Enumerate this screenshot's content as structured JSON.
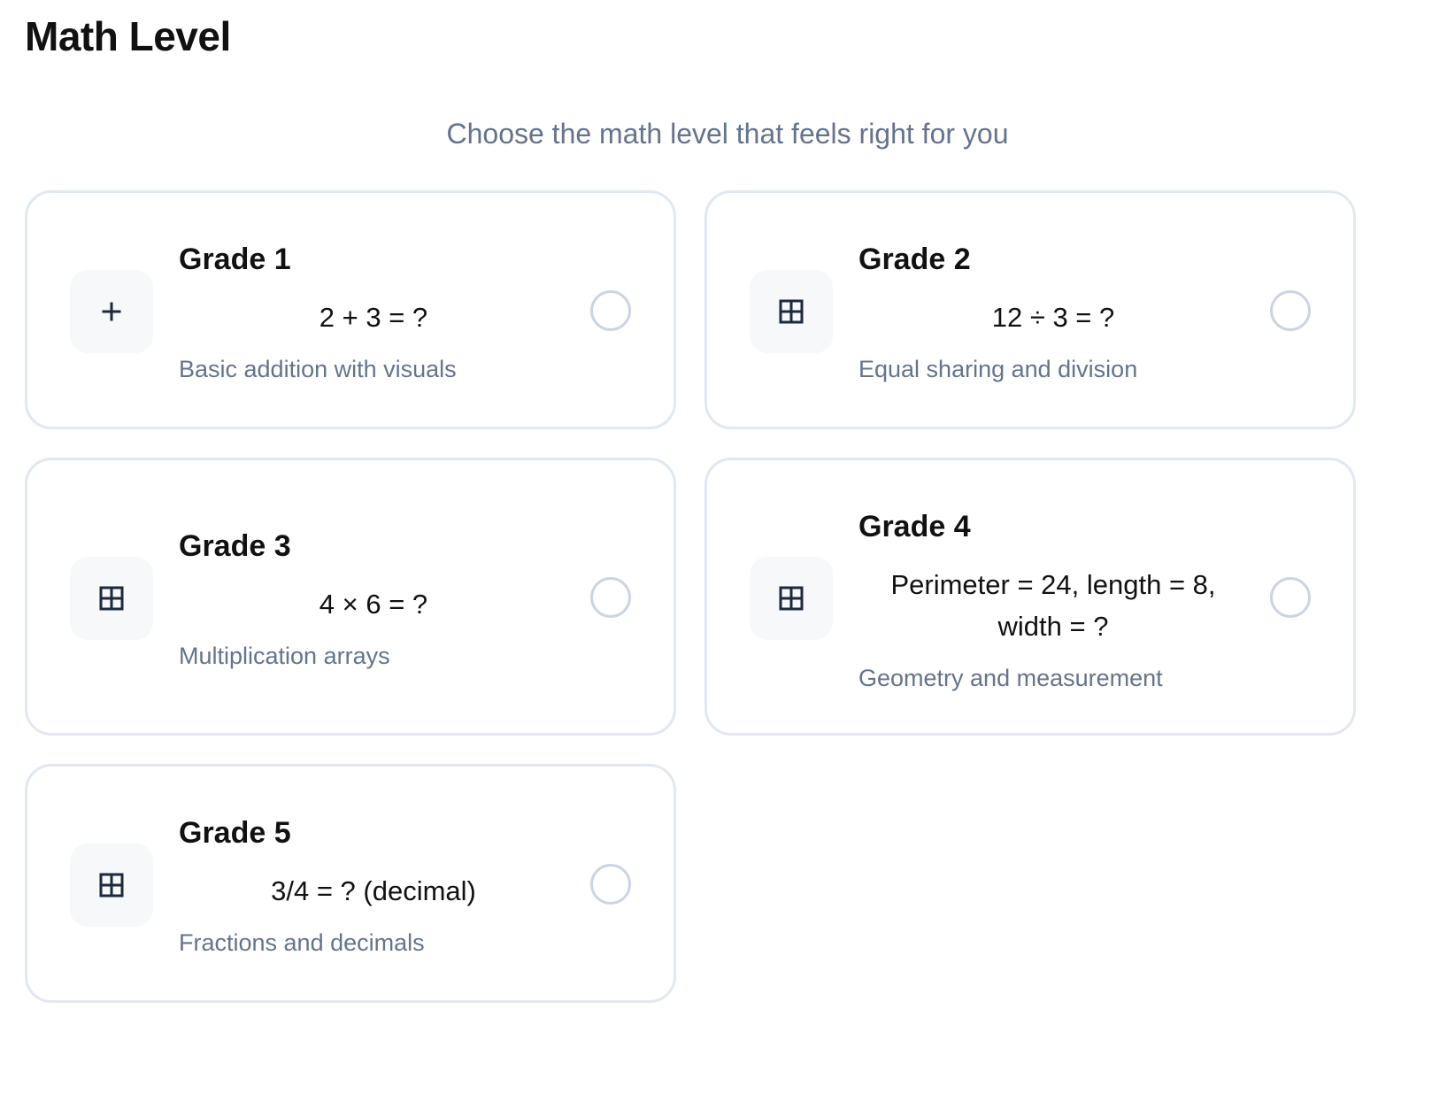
{
  "page": {
    "title": "Math Level",
    "subtitle": "Choose the math level that feels right for you"
  },
  "levels": [
    {
      "grade": "Grade 1",
      "problem": "2 + 3 = ?",
      "description": "Basic addition with visuals",
      "icon": "plus-icon",
      "selected": false
    },
    {
      "grade": "Grade 2",
      "problem": "12 ÷ 3 = ?",
      "description": "Equal sharing and division",
      "icon": "grid-icon",
      "selected": false
    },
    {
      "grade": "Grade 3",
      "problem": "4 × 6 = ?",
      "description": "Multiplication arrays",
      "icon": "grid-icon",
      "selected": false
    },
    {
      "grade": "Grade 4",
      "problem": "Perimeter = 24, length = 8, width = ?",
      "description": "Geometry and measurement",
      "icon": "grid-icon",
      "selected": false
    },
    {
      "grade": "Grade 5",
      "problem": "3/4 = ? (decimal)",
      "description": "Fractions and decimals",
      "icon": "grid-icon",
      "selected": false
    }
  ],
  "colors": {
    "title": "#111111",
    "muted_text": "#64748b",
    "card_border": "#e2e8f0",
    "icon_background": "#f6f8fa",
    "radio_border": "#cbd5e1",
    "icon_color": "#1e293b"
  }
}
